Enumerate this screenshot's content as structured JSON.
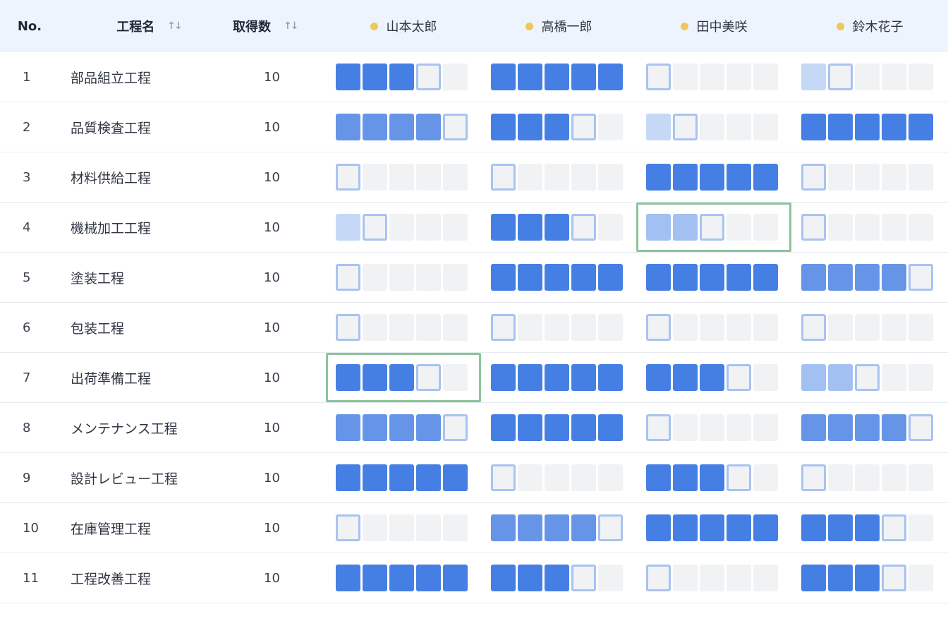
{
  "columns": {
    "no": "No.",
    "process_name": "工程名",
    "count": "取得数",
    "sort_icon": "sort-icon"
  },
  "people": [
    "山本太郎",
    "高橋一郎",
    "田中美咲",
    "鈴木花子"
  ],
  "status_colors": {
    "person_dot": "#f0c855",
    "level_strong": "#467fe4",
    "level_mid": "#6695e8",
    "level_soft": "#a2c0f1",
    "level_pale": "#c5d8f6",
    "empty": "#f1f2f4",
    "current_outline": "#a8c3f1",
    "highlight": "#8cc49c"
  },
  "rows": [
    {
      "no": "1",
      "name": "部品組立工程",
      "count": "10",
      "skills": [
        {
          "level": 3,
          "tone": "strong"
        },
        {
          "level": 5,
          "tone": "strong"
        },
        {
          "level": 0,
          "tone": "none"
        },
        {
          "level": 1,
          "tone": "pale"
        }
      ]
    },
    {
      "no": "2",
      "name": "品質検査工程",
      "count": "10",
      "skills": [
        {
          "level": 4,
          "tone": "mid"
        },
        {
          "level": 3,
          "tone": "strong"
        },
        {
          "level": 1,
          "tone": "pale"
        },
        {
          "level": 5,
          "tone": "strong"
        }
      ]
    },
    {
      "no": "3",
      "name": "材料供給工程",
      "count": "10",
      "skills": [
        {
          "level": 0,
          "tone": "none"
        },
        {
          "level": 0,
          "tone": "none"
        },
        {
          "level": 5,
          "tone": "strong"
        },
        {
          "level": 0,
          "tone": "none"
        }
      ]
    },
    {
      "no": "4",
      "name": "機械加工工程",
      "count": "10",
      "skills": [
        {
          "level": 1,
          "tone": "pale"
        },
        {
          "level": 3,
          "tone": "strong"
        },
        {
          "level": 2,
          "tone": "soft",
          "highlight": true
        },
        {
          "level": 0,
          "tone": "none"
        }
      ]
    },
    {
      "no": "5",
      "name": "塗装工程",
      "count": "10",
      "skills": [
        {
          "level": 0,
          "tone": "none"
        },
        {
          "level": 5,
          "tone": "strong"
        },
        {
          "level": 5,
          "tone": "strong"
        },
        {
          "level": 4,
          "tone": "mid"
        }
      ]
    },
    {
      "no": "6",
      "name": "包装工程",
      "count": "10",
      "skills": [
        {
          "level": 0,
          "tone": "none"
        },
        {
          "level": 0,
          "tone": "none"
        },
        {
          "level": 0,
          "tone": "none"
        },
        {
          "level": 0,
          "tone": "none"
        }
      ]
    },
    {
      "no": "7",
      "name": "出荷準備工程",
      "count": "10",
      "skills": [
        {
          "level": 3,
          "tone": "strong",
          "highlight": true
        },
        {
          "level": 5,
          "tone": "strong"
        },
        {
          "level": 3,
          "tone": "strong"
        },
        {
          "level": 2,
          "tone": "soft"
        }
      ]
    },
    {
      "no": "8",
      "name": "メンテナンス工程",
      "count": "10",
      "skills": [
        {
          "level": 4,
          "tone": "mid"
        },
        {
          "level": 5,
          "tone": "strong"
        },
        {
          "level": 0,
          "tone": "none"
        },
        {
          "level": 4,
          "tone": "mid"
        }
      ]
    },
    {
      "no": "9",
      "name": "設計レビュー工程",
      "count": "10",
      "skills": [
        {
          "level": 5,
          "tone": "strong"
        },
        {
          "level": 0,
          "tone": "none"
        },
        {
          "level": 3,
          "tone": "strong"
        },
        {
          "level": 0,
          "tone": "none"
        }
      ]
    },
    {
      "no": "10",
      "name": "在庫管理工程",
      "count": "10",
      "skills": [
        {
          "level": 0,
          "tone": "none"
        },
        {
          "level": 4,
          "tone": "mid"
        },
        {
          "level": 5,
          "tone": "strong"
        },
        {
          "level": 3,
          "tone": "strong"
        }
      ]
    },
    {
      "no": "11",
      "name": "工程改善工程",
      "count": "10",
      "skills": [
        {
          "level": 5,
          "tone": "strong"
        },
        {
          "level": 3,
          "tone": "strong"
        },
        {
          "level": 0,
          "tone": "none"
        },
        {
          "level": 3,
          "tone": "strong"
        }
      ]
    }
  ]
}
